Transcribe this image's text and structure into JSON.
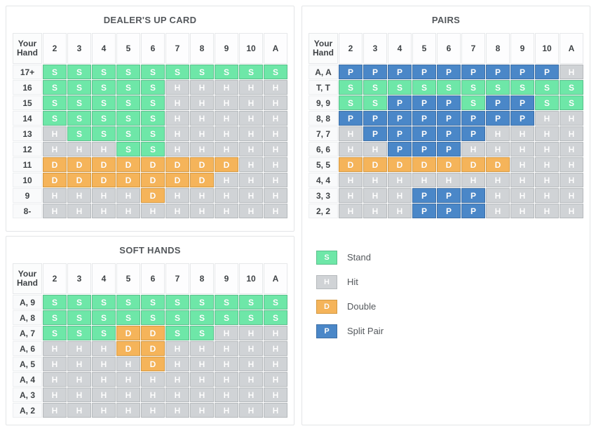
{
  "colors": {
    "stand": "#6ee7a8",
    "hit": "#d0d3d6",
    "double": "#f5b45a",
    "split": "#4a87c8",
    "panel_border": "#e3e5e7",
    "title_text": "#54585c"
  },
  "tables": {
    "hard": {
      "title": "DEALER'S UP CARD",
      "corner_label_line1": "Your",
      "corner_label_line2": "Hand",
      "columns": [
        "2",
        "3",
        "4",
        "5",
        "6",
        "7",
        "8",
        "9",
        "10",
        "A"
      ],
      "rows": [
        {
          "label": "17+",
          "cells": [
            "S",
            "S",
            "S",
            "S",
            "S",
            "S",
            "S",
            "S",
            "S",
            "S"
          ]
        },
        {
          "label": "16",
          "cells": [
            "S",
            "S",
            "S",
            "S",
            "S",
            "H",
            "H",
            "H",
            "H",
            "H"
          ]
        },
        {
          "label": "15",
          "cells": [
            "S",
            "S",
            "S",
            "S",
            "S",
            "H",
            "H",
            "H",
            "H",
            "H"
          ]
        },
        {
          "label": "14",
          "cells": [
            "S",
            "S",
            "S",
            "S",
            "S",
            "H",
            "H",
            "H",
            "H",
            "H"
          ]
        },
        {
          "label": "13",
          "cells": [
            "H",
            "S",
            "S",
            "S",
            "S",
            "H",
            "H",
            "H",
            "H",
            "H"
          ]
        },
        {
          "label": "12",
          "cells": [
            "H",
            "H",
            "H",
            "S",
            "S",
            "H",
            "H",
            "H",
            "H",
            "H"
          ]
        },
        {
          "label": "11",
          "cells": [
            "D",
            "D",
            "D",
            "D",
            "D",
            "D",
            "D",
            "D",
            "H",
            "H"
          ]
        },
        {
          "label": "10",
          "cells": [
            "D",
            "D",
            "D",
            "D",
            "D",
            "D",
            "D",
            "H",
            "H",
            "H"
          ]
        },
        {
          "label": "9",
          "cells": [
            "H",
            "H",
            "H",
            "H",
            "D",
            "H",
            "H",
            "H",
            "H",
            "H"
          ]
        },
        {
          "label": "8-",
          "cells": [
            "H",
            "H",
            "H",
            "H",
            "H",
            "H",
            "H",
            "H",
            "H",
            "H"
          ]
        }
      ]
    },
    "soft": {
      "title": "SOFT HANDS",
      "corner_label_line1": "Your",
      "corner_label_line2": "Hand",
      "columns": [
        "2",
        "3",
        "4",
        "5",
        "6",
        "7",
        "8",
        "9",
        "10",
        "A"
      ],
      "rows": [
        {
          "label": "A, 9",
          "cells": [
            "S",
            "S",
            "S",
            "S",
            "S",
            "S",
            "S",
            "S",
            "S",
            "S"
          ]
        },
        {
          "label": "A, 8",
          "cells": [
            "S",
            "S",
            "S",
            "S",
            "S",
            "S",
            "S",
            "S",
            "S",
            "S"
          ]
        },
        {
          "label": "A, 7",
          "cells": [
            "S",
            "S",
            "S",
            "D",
            "D",
            "S",
            "S",
            "H",
            "H",
            "H"
          ]
        },
        {
          "label": "A, 6",
          "cells": [
            "H",
            "H",
            "H",
            "D",
            "D",
            "H",
            "H",
            "H",
            "H",
            "H"
          ]
        },
        {
          "label": "A, 5",
          "cells": [
            "H",
            "H",
            "H",
            "H",
            "D",
            "H",
            "H",
            "H",
            "H",
            "H"
          ]
        },
        {
          "label": "A, 4",
          "cells": [
            "H",
            "H",
            "H",
            "H",
            "H",
            "H",
            "H",
            "H",
            "H",
            "H"
          ]
        },
        {
          "label": "A, 3",
          "cells": [
            "H",
            "H",
            "H",
            "H",
            "H",
            "H",
            "H",
            "H",
            "H",
            "H"
          ]
        },
        {
          "label": "A, 2",
          "cells": [
            "H",
            "H",
            "H",
            "H",
            "H",
            "H",
            "H",
            "H",
            "H",
            "H"
          ]
        }
      ]
    },
    "pairs": {
      "title": "PAIRS",
      "corner_label_line1": "Your",
      "corner_label_line2": "Hand",
      "columns": [
        "2",
        "3",
        "4",
        "5",
        "6",
        "7",
        "8",
        "9",
        "10",
        "A"
      ],
      "rows": [
        {
          "label": "A, A",
          "cells": [
            "P",
            "P",
            "P",
            "P",
            "P",
            "P",
            "P",
            "P",
            "P",
            "H"
          ]
        },
        {
          "label": "T, T",
          "cells": [
            "S",
            "S",
            "S",
            "S",
            "S",
            "S",
            "S",
            "S",
            "S",
            "S"
          ]
        },
        {
          "label": "9, 9",
          "cells": [
            "S",
            "S",
            "P",
            "P",
            "P",
            "S",
            "P",
            "P",
            "S",
            "S"
          ]
        },
        {
          "label": "8, 8",
          "cells": [
            "P",
            "P",
            "P",
            "P",
            "P",
            "P",
            "P",
            "P",
            "H",
            "H"
          ]
        },
        {
          "label": "7, 7",
          "cells": [
            "H",
            "P",
            "P",
            "P",
            "P",
            "P",
            "H",
            "H",
            "H",
            "H"
          ]
        },
        {
          "label": "6, 6",
          "cells": [
            "H",
            "H",
            "P",
            "P",
            "P",
            "H",
            "H",
            "H",
            "H",
            "H"
          ]
        },
        {
          "label": "5, 5",
          "cells": [
            "D",
            "D",
            "D",
            "D",
            "D",
            "D",
            "D",
            "H",
            "H",
            "H"
          ]
        },
        {
          "label": "4, 4",
          "cells": [
            "H",
            "H",
            "H",
            "H",
            "H",
            "H",
            "H",
            "H",
            "H",
            "H"
          ]
        },
        {
          "label": "3, 3",
          "cells": [
            "H",
            "H",
            "H",
            "P",
            "P",
            "P",
            "H",
            "H",
            "H",
            "H"
          ]
        },
        {
          "label": "2, 2",
          "cells": [
            "H",
            "H",
            "H",
            "P",
            "P",
            "P",
            "H",
            "H",
            "H",
            "H"
          ]
        }
      ]
    }
  },
  "legend": {
    "items": [
      {
        "code": "S",
        "label": "Stand"
      },
      {
        "code": "H",
        "label": "Hit"
      },
      {
        "code": "D",
        "label": "Double"
      },
      {
        "code": "P",
        "label": "Split Pair"
      }
    ]
  }
}
